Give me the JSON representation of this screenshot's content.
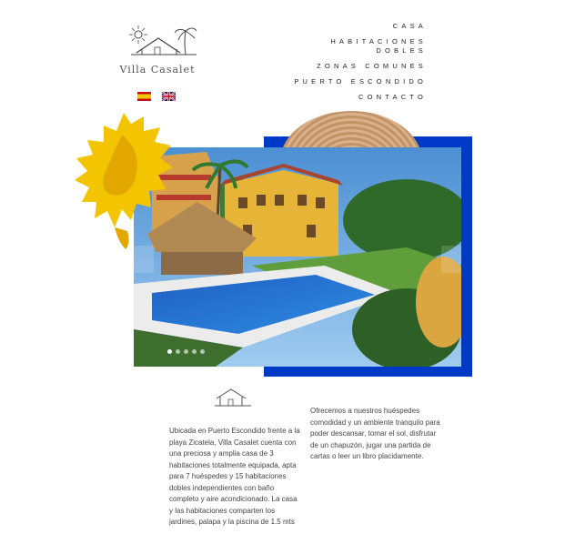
{
  "logo": {
    "text": "Villa Casalet"
  },
  "languages": [
    {
      "name": "Español",
      "code": "es"
    },
    {
      "name": "English",
      "code": "en"
    }
  ],
  "nav": {
    "items": [
      "CASA",
      "HABITACIONES DOBLES",
      "ZONAS COMUNES",
      "PUERTO ESCONDIDO",
      "CONTACTO"
    ]
  },
  "slider": {
    "slide_count": 5,
    "active_slide": 1
  },
  "content": {
    "left_text": "Ubicada en Puerto Escondido frente a la playa Zicatela, Villa Casalet cuenta con una preciosa y amplia casa de 3 habitaciones totalmente equipada, apta para 7 huéspedes y 15 habitaciones dobles independientes con baño completo y aire acondicionado. La casa y las habitaciones comparten los jardines, palapa y la piscina de 1.5 mts",
    "right_text": "Ofrecemos a nuestros huéspedes comodidad y un ambiente tranquilo para poder descansar, tomar el sol, disfrutar de un chapuzón, jugar una partida de cartas o leer un libro placidamente."
  },
  "colors": {
    "accent_blue": "#0039c7",
    "shell_yellow": "#f2c500"
  }
}
